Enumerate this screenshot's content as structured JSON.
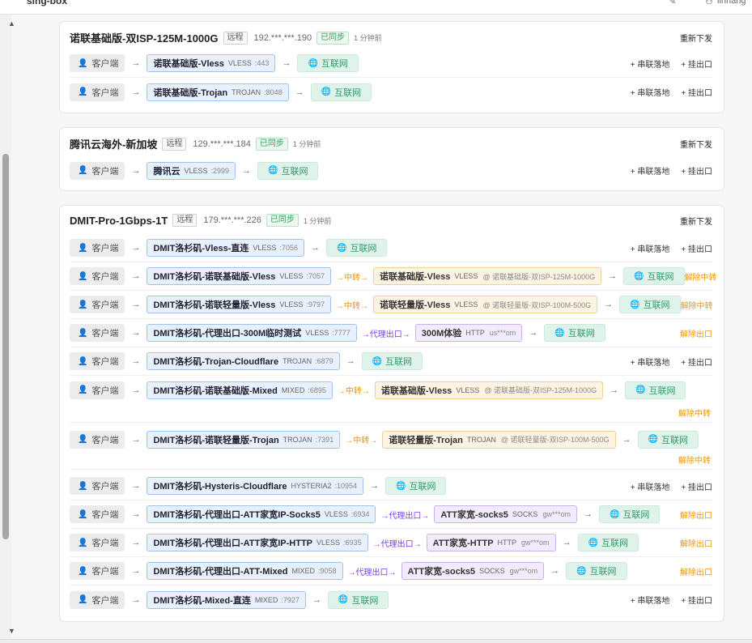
{
  "app": {
    "title": "sing-box",
    "user": "linhang"
  },
  "labels": {
    "client": "客户端",
    "internet": "互联网",
    "redeploy": "重新下发",
    "add_chain": "+ 串联落地",
    "add_exit": "+ 挂出口",
    "remove_relay": "解除中转",
    "remove_exit": "解除出口",
    "via_relay": "→中转→",
    "via_proxy": "→代理出口→",
    "remote": "远程",
    "synced": "已同步",
    "arrow": "→"
  },
  "servers": [
    {
      "name": "诺联基础版-双ISP-125M-1000G",
      "ip": "192.***.***.190",
      "ago": "1 分钟前",
      "routes": [
        {
          "inbound": "诺联基础版-Vless",
          "proto": "VLESS",
          "port": ":443"
        },
        {
          "inbound": "诺联基础版-Trojan",
          "proto": "TROJAN",
          "port": ":8048"
        }
      ]
    },
    {
      "name": "腾讯云海外-新加坡",
      "ip": "129.***.***.184",
      "ago": "1 分钟前",
      "routes": [
        {
          "inbound": "腾讯云",
          "proto": "VLESS",
          "port": ":2999"
        }
      ]
    },
    {
      "name": "DMIT-Pro-1Gbps-1T",
      "ip": "179.***.***.226",
      "ago": "1 分钟前",
      "routes": [
        {
          "inbound": "DMIT洛杉矶-Vless-直连",
          "proto": "VLESS",
          "port": ":7056"
        },
        {
          "inbound": "DMIT洛杉矶-诺联基础版-Vless",
          "proto": "VLESS",
          "port": ":7057",
          "via": "relay",
          "target": "诺联基础版-Vless",
          "tproto": "VLESS",
          "tnode": "@ 诺联基础版-双ISP-125M-1000G"
        },
        {
          "inbound": "DMIT洛杉矶-诺联轻量版-Vless",
          "proto": "VLESS",
          "port": ":9797",
          "via": "relay",
          "target": "诺联轻量版-Vless",
          "tproto": "VLESS",
          "tnode": "@ 诺联轻量版-双ISP-100M-500G"
        },
        {
          "inbound": "DMIT洛杉矶-代理出口-300M临时测试",
          "proto": "VLESS",
          "port": ":7777",
          "via": "proxy",
          "target": "300M体验",
          "tproto": "HTTP",
          "tnode": "us***om"
        },
        {
          "inbound": "DMIT洛杉矶-Trojan-Cloudflare",
          "proto": "TROJAN",
          "port": ":6879"
        },
        {
          "inbound": "DMIT洛杉矶-诺联基础版-Mixed",
          "proto": "MIXED",
          "port": ":6895",
          "via": "relay",
          "target": "诺联基础版-Vless",
          "tproto": "VLESS",
          "tnode": "@ 诺联基础版-双ISP-125M-1000G"
        },
        {
          "inbound": "DMIT洛杉矶-诺联轻量版-Trojan",
          "proto": "TROJAN",
          "port": ":7391",
          "via": "relay",
          "target": "诺联轻量版-Trojan",
          "tproto": "TROJAN",
          "tnode": "@ 诺联轻量版-双ISP-100M-500G"
        },
        {
          "inbound": "DMIT洛杉矶-Hysteris-Cloudflare",
          "proto": "HYSTERIA2",
          "port": ":10954"
        },
        {
          "inbound": "DMIT洛杉矶-代理出口-ATT家宽IP-Socks5",
          "proto": "VLESS",
          "port": ":6934",
          "via": "proxy",
          "target": "ATT家宽-socks5",
          "tproto": "SOCKS",
          "tnode": "gw***om"
        },
        {
          "inbound": "DMIT洛杉矶-代理出口-ATT家宽IP-HTTP",
          "proto": "VLESS",
          "port": ":6935",
          "via": "proxy",
          "target": "ATT家宽-HTTP",
          "tproto": "HTTP",
          "tnode": "gw***om"
        },
        {
          "inbound": "DMIT洛杉矶-代理出口-ATT-Mixed",
          "proto": "MIXED",
          "port": ":9058",
          "via": "proxy",
          "target": "ATT家宽-socks5",
          "tproto": "SOCKS",
          "tnode": "gw***om"
        },
        {
          "inbound": "DMIT洛杉矶-Mixed-直连",
          "proto": "MIXED",
          "port": ":7927"
        }
      ]
    }
  ]
}
